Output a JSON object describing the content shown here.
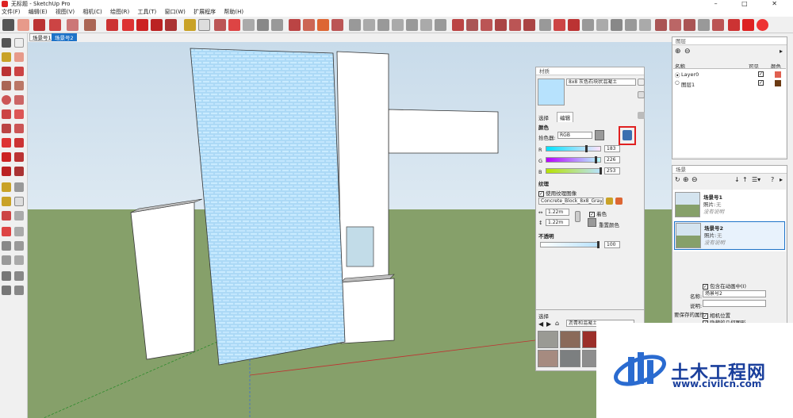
{
  "window": {
    "title": "无标题 - SketchUp Pro",
    "controls": "– □ ✕"
  },
  "menu": [
    "文件(F)",
    "编辑(E)",
    "视图(V)",
    "相机(C)",
    "绘图(R)",
    "工具(T)",
    "窗口(W)",
    "扩展程序",
    "帮助(H)"
  ],
  "scene_tabs": [
    {
      "label": "场景号1",
      "active": false
    },
    {
      "label": "场景号2",
      "active": true
    }
  ],
  "materials": {
    "panel_title": "材质",
    "material_name": "8x8 灰色石块状混凝土",
    "tabs": [
      "选择",
      "编辑"
    ],
    "color_section": "颜色",
    "picker_label": "拾色器:",
    "picker_value": "RGB",
    "channels": [
      {
        "name": "R",
        "value": "183",
        "fraction": 0.72
      },
      {
        "name": "G",
        "value": "226",
        "fraction": 0.89
      },
      {
        "name": "B",
        "value": "253",
        "fraction": 0.99
      }
    ],
    "texture_section": "纹理",
    "use_texture_label": "使用纹理图像",
    "texture_file": "Concrete_Block_8x8_Gray.jpg",
    "width_value": "1.22m",
    "height_value": "1.22m",
    "colorize_label": "着色",
    "reset_color_label": "重置颜色",
    "opacity_section": "不透明",
    "opacity_value": "100",
    "select_section": "选择",
    "category_value": "沥青和混凝土"
  },
  "layers": {
    "panel_title": "图层",
    "columns": [
      "名称",
      "可见",
      "颜色"
    ],
    "rows": [
      {
        "name": "Layer0",
        "color": "#e06050"
      },
      {
        "name": "图层1",
        "color": "#6b3a12"
      }
    ]
  },
  "scenes": {
    "panel_title": "场景",
    "items": [
      {
        "name": "场景号1",
        "photo_label": "照片:",
        "photo_value": "无",
        "desc": "没有说明"
      },
      {
        "name": "场景号2",
        "photo_label": "照片:",
        "photo_value": "无",
        "desc": "没有说明"
      }
    ],
    "include_anim_label": "包含在动画中(I)",
    "name_label": "名称:",
    "name_value": "场景号2",
    "desc_label": "说明:",
    "save_props_label": "要保存的属性:",
    "camera_pos_label": "相机位置",
    "hidden_geom_label": "隐藏的几何图形"
  },
  "watermark": {
    "title": "土木工程网",
    "url": "www.civilcn.com"
  },
  "colors": {
    "accent": "#1e73c8",
    "highlight_red": "#e02020",
    "sky": "#d4e4ef",
    "ground": "#86a06a",
    "tile_blue": "#b7e2fd"
  }
}
